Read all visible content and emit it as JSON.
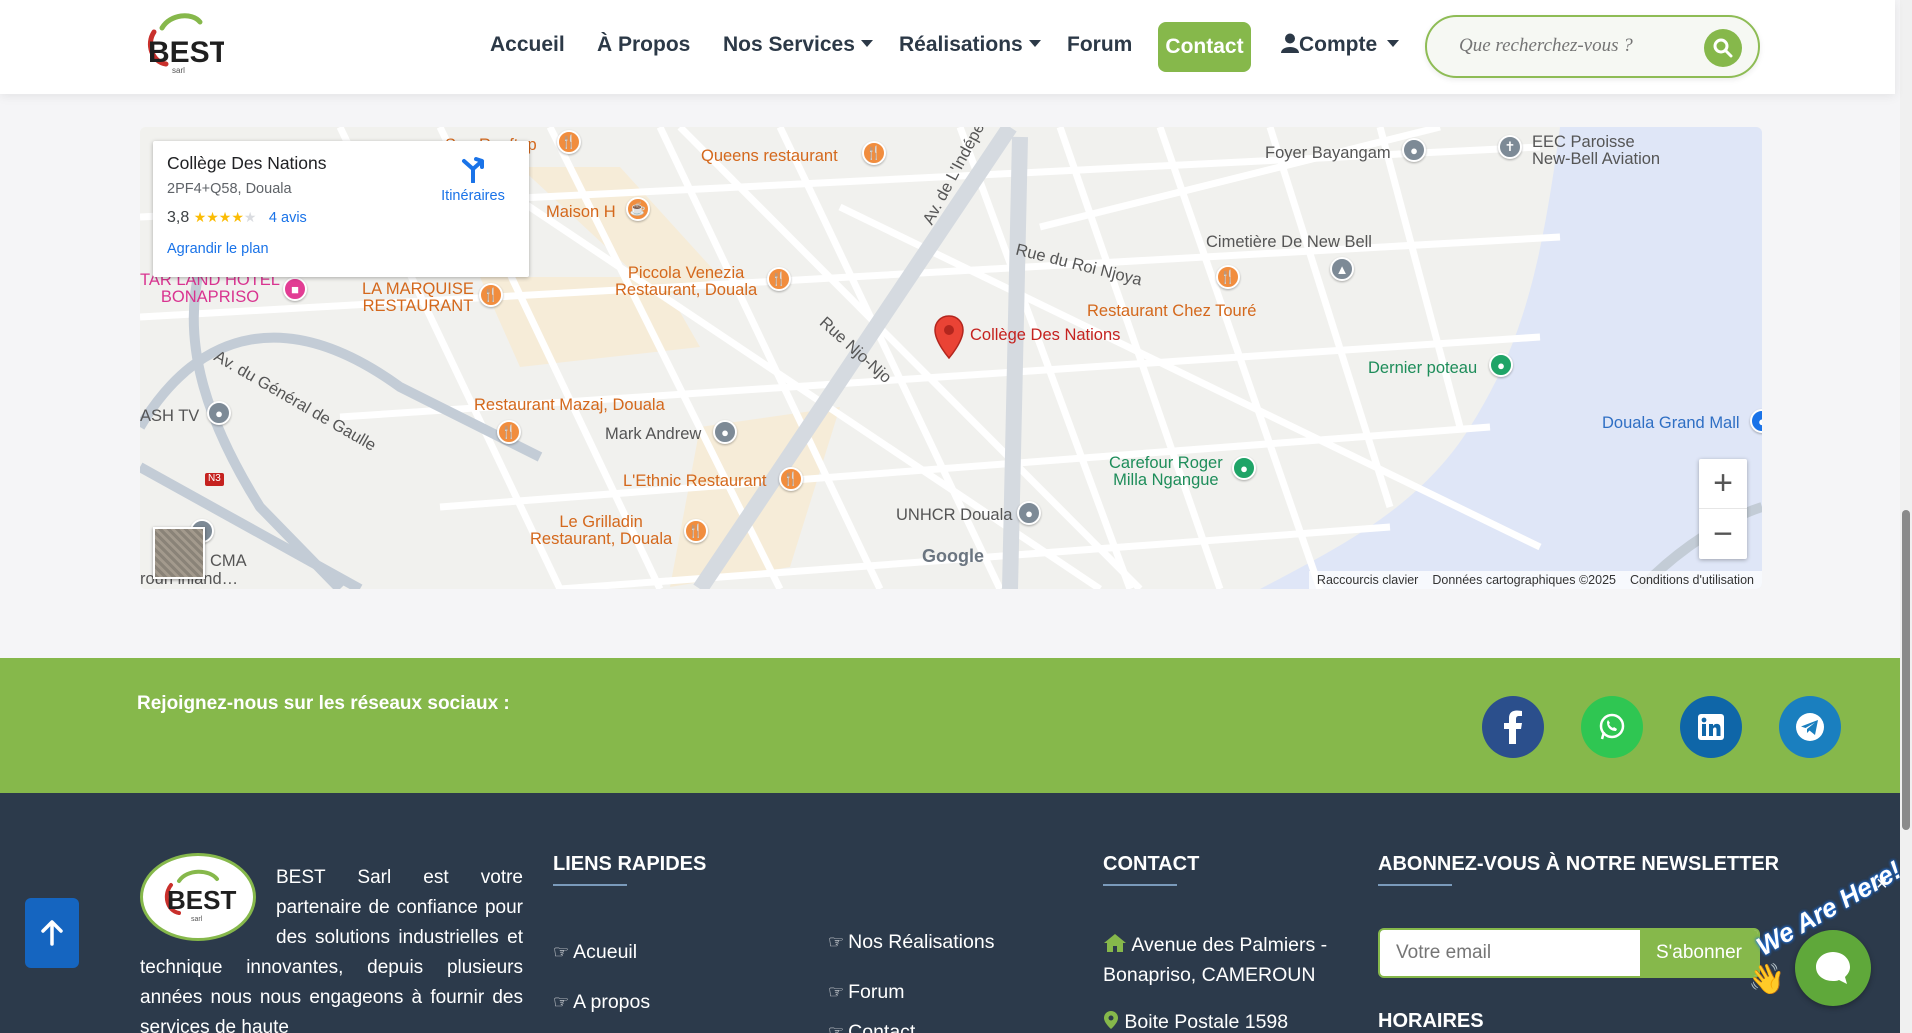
{
  "nav": {
    "logo_text": "BEST",
    "logo_sub": "sarl",
    "items": [
      "Accueil",
      "À Propos",
      "Nos Services",
      "Réalisations",
      "Forum"
    ],
    "contact_label": "Contact",
    "account_label": "Compte",
    "search_placeholder": "Que recherchez-vous ?"
  },
  "map": {
    "place_name": "Collège Des Nations",
    "address": "2PF4+Q58, Douala",
    "rating": "3,8",
    "stars": "★★★★",
    "star_empty": "★",
    "reviews": "4 avis",
    "directions": "Itinéraires",
    "enlarge": "Agrandir le plan",
    "pin_label": "Collège Des Nations",
    "labels": {
      "rooftop": "Sun Rooftop",
      "queens": "Queens restaurant",
      "foyer": "Foyer Bayangam",
      "eec": "EEC Paroisse\nNew-Bell Aviation",
      "maison": "Maison H",
      "cimetiere": "Cimetière De New Bell",
      "piccola": "Piccola Venezia\nRestaurant, Douala",
      "starland": "TAR LAND HOTEL\nBONAPRISO",
      "marquise": "LA MARQUISE\nRESTAURANT",
      "chez_toure": "Restaurant Chez Touré",
      "roi_njoya": "Rue du Roi Njoya",
      "independance": "Av. de L'Indépendance",
      "njo_njo": "Rue Njo-Njo",
      "gaulle": "Av. du Général de Gaulle",
      "dernier": "Dernier poteau",
      "grand_mall": "Douala Grand Mall",
      "ash_tv": "ASH TV",
      "mazaj": "Restaurant Mazaj, Douala",
      "mark": "Mark Andrew",
      "ethnic": "L'Ethnic Restaurant",
      "carrefour": "Carefour Roger\nMilla Ngangue",
      "grilladin": "Le Grilladin\nRestaurant, Douala",
      "unhcr": "UNHCR Douala",
      "cma": "CMA",
      "cma2": "roun inland…",
      "n3": "N3"
    },
    "google": "Google",
    "footer": [
      "Raccourcis clavier",
      "Données cartographiques ©2025",
      "Conditions d'utilisation"
    ],
    "zoom_in": "+",
    "zoom_out": "−"
  },
  "social": {
    "title": "Rejoignez-nous sur les réseaux sociaux :",
    "icons": [
      "facebook-icon",
      "whatsapp-icon",
      "linkedin-icon",
      "telegram-icon"
    ],
    "colors": [
      "#2b4f8c",
      "#2fc652",
      "#0f66a8",
      "#1a7fbf"
    ]
  },
  "footer": {
    "logo_text": "BEST",
    "logo_sub": "sarl",
    "about": "BEST Sarl est votre partenaire de confiance pour des solutions industrielles et technique innovantes, depuis plusieurs années nous nous engageons à fournir des services de haute",
    "quick_links_title": "LIENS RAPIDES",
    "links_col1": [
      "Acueuil",
      "A propos"
    ],
    "links_col2": [
      "Nos Réalisations",
      "Forum",
      "Contact"
    ],
    "contact_title": "CONTACT",
    "address": "Avenue des Palmiers - Bonapriso, CAMEROUN",
    "po_box": "Boite Postale 1598",
    "newsletter_title": "ABONNEZ-VOUS À NOTRE NEWSLETTER",
    "email_placeholder": "Votre email",
    "subscribe": "S'abonner",
    "hours_title": "HORAIRES"
  },
  "chat": {
    "tagline": "We Are Here!",
    "close": "×"
  },
  "colors": {
    "accent": "#86b84b",
    "footer_bg": "#2c3a4b",
    "nav_text": "#2c3947"
  }
}
